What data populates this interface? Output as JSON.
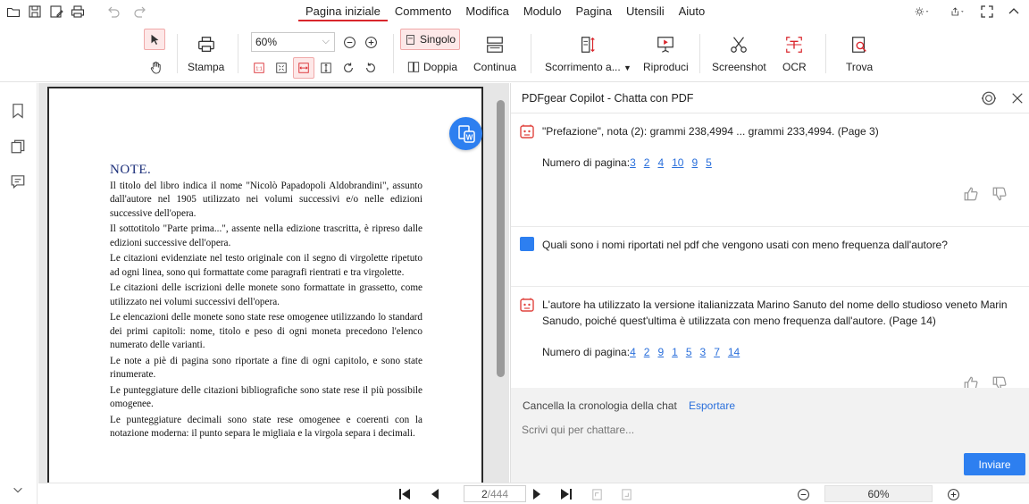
{
  "menu": {
    "tabs": [
      "Pagina iniziale",
      "Commento",
      "Modifica",
      "Modulo",
      "Pagina",
      "Utensili",
      "Aiuto"
    ],
    "active_tab": "Pagina iniziale"
  },
  "ribbon": {
    "print_label": "Stampa",
    "zoom_value": "60%",
    "single_label": "Singolo",
    "double_label": "Doppia",
    "continuous_label": "Continua",
    "scroll_label": "Scorrimento a...",
    "play_label": "Riproduci",
    "screenshot_label": "Screenshot",
    "ocr_label": "OCR",
    "find_label": "Trova"
  },
  "document": {
    "heading": "NOTE.",
    "paragraphs": [
      "Il titolo del libro indica il nome \"Nicolò Papadopoli Aldobrandini\", assunto dall'autore nel 1905 utilizzato nei volumi successivi e/o nelle edizioni successive dell'opera.",
      "Il sottotitolo \"Parte prima...\", assente nella edizione trascritta, è ripreso dalle edizioni successive dell'opera.",
      "Le citazioni evidenziate nel testo originale con il segno di virgolette ripetuto ad ogni linea, sono qui formattate come paragrafi rientrati e tra virgolette.",
      "Le citazioni delle iscrizioni delle monete sono formattate in grassetto, come utilizzato nei volumi successivi dell'opera.",
      "Le elencazioni delle monete sono state rese omogenee utilizzando lo standard dei primi capitoli: nome, titolo e peso di ogni moneta precedono l'elenco numerato delle varianti.",
      "Le note a piè di pagina sono riportate a fine di ogni capitolo, e sono state rinumerate.",
      "Le punteggiature delle citazioni bibliografiche sono state rese il più possibile omogenee.",
      "Le punteggiature decimali sono state rese omogenee e coerenti con la notazione moderna: il punto separa le migliaia e la virgola separa i decimali."
    ]
  },
  "copilot": {
    "title": "PDFgear Copilot - Chatta con PDF",
    "messages": [
      {
        "role": "assistant",
        "text": "\"Prefazione\", nota (2): grammi 238,4994 ... grammi 233,4994. (Page 3)",
        "pages_label": "Numero di pagina:",
        "pages": [
          "3",
          "2",
          "4",
          "10",
          "9",
          "5"
        ]
      },
      {
        "role": "user",
        "text": "Quali sono i nomi riportati nel pdf che vengono usati con meno frequenza dall'autore?"
      },
      {
        "role": "assistant",
        "text": "L'autore ha utilizzato la versione italianizzata Marino Sanuto del nome dello studioso veneto Marin Sanudo, poiché quest'ultima è utilizzata con meno frequenza dall'autore. (Page 14)",
        "pages_label": "Numero di pagina:",
        "pages": [
          "4",
          "2",
          "9",
          "1",
          "5",
          "3",
          "7",
          "14"
        ]
      }
    ],
    "clear_label": "Cancella la cronologia della chat",
    "export_label": "Esportare",
    "input_placeholder": "Scrivi qui per chattare...",
    "send_label": "Inviare"
  },
  "status": {
    "current_page": "2",
    "total_pages": "/444",
    "zoom": "60%"
  },
  "colors": {
    "accent_red": "#d9262c",
    "accent_blue": "#2d7ff0",
    "link_blue": "#2a6fdb",
    "doc_heading": "#1c2f7a"
  }
}
